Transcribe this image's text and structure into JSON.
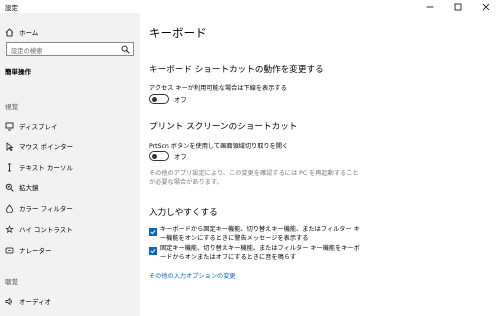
{
  "window": {
    "title": "設定"
  },
  "sidebar": {
    "home_label": "ホーム",
    "search_placeholder": "設定の検索",
    "group_title": "簡単操作",
    "section_vision": "視覚",
    "section_hearing": "聴覚",
    "items": [
      {
        "label": "ディスプレイ",
        "icon": "display-icon"
      },
      {
        "label": "マウス ポインター",
        "icon": "mouse-pointer-icon"
      },
      {
        "label": "テキスト カーソル",
        "icon": "text-cursor-icon"
      },
      {
        "label": "拡大鏡",
        "icon": "magnifier-icon"
      },
      {
        "label": "カラー フィルター",
        "icon": "color-filter-icon"
      },
      {
        "label": "ハイ コントラスト",
        "icon": "high-contrast-icon"
      },
      {
        "label": "ナレーター",
        "icon": "narrator-icon"
      },
      {
        "label": "オーディオ",
        "icon": "audio-icon"
      }
    ]
  },
  "main": {
    "title": "キーボード",
    "shortcut_section": {
      "heading": "キーボード ショートカットの動作を変更する",
      "setting_label": "アクセス キーが利用可能な場合は下線を表示する",
      "state": "オフ"
    },
    "printscreen_section": {
      "heading": "プリント スクリーンのショートカット",
      "setting_label": "PrtScn ボタンを使用して画面領域切り取りを開く",
      "state": "オフ",
      "note": "その他のアプリ設定により、この変更を確認するには PC を再起動することが必要な場合があります。"
    },
    "typing_section": {
      "heading": "入力しやすくする",
      "checkbox1": "キーボードから固定キー機能、切り替えキー機能、またはフィルター キー機能をオンにするときに警告メッセージを表示する",
      "checkbox2": "固定キー機能、切り替えキー機能、またはフィルター キー機能をキーボードからオンまたはオフにするときに音を鳴らす",
      "link": "その他の入力オプションの変更"
    }
  },
  "colors": {
    "accent": "#0067c0",
    "sidebar_bg": "#f2f2f2"
  }
}
